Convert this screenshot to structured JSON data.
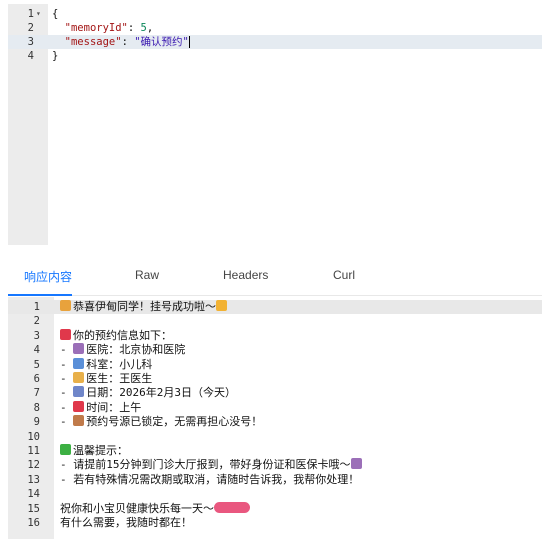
{
  "request_editor": {
    "lines": [
      {
        "num": "1",
        "fold": "▾",
        "parts": [
          {
            "t": "{",
            "c": ""
          }
        ]
      },
      {
        "num": "2",
        "fold": "",
        "parts": [
          {
            "t": "  ",
            "c": ""
          },
          {
            "t": "\"memoryId\"",
            "c": "k"
          },
          {
            "t": ": ",
            "c": ""
          },
          {
            "t": "5",
            "c": "n"
          },
          {
            "t": ",",
            "c": ""
          }
        ]
      },
      {
        "num": "3",
        "fold": "",
        "parts": [
          {
            "t": "  ",
            "c": ""
          },
          {
            "t": "\"message\"",
            "c": "k"
          },
          {
            "t": ": ",
            "c": ""
          },
          {
            "t": "\"确认预约\"",
            "c": "s"
          }
        ],
        "active": true
      },
      {
        "num": "4",
        "fold": "",
        "parts": [
          {
            "t": "}",
            "c": ""
          }
        ]
      }
    ]
  },
  "tabs": [
    {
      "label": "响应内容",
      "active": true
    },
    {
      "label": "Raw",
      "active": false
    },
    {
      "label": "Headers",
      "active": false
    },
    {
      "label": "Curl",
      "active": false
    }
  ],
  "response_editor": {
    "lines": [
      {
        "num": "1",
        "icon": "party-icon",
        "text": "恭喜伊甸同学！挂号成功啦～",
        "tail_icon": "sparkle-icon"
      },
      {
        "num": "2",
        "text": ""
      },
      {
        "num": "3",
        "icon": "pin-icon",
        "text": "你的预约信息如下："
      },
      {
        "num": "4",
        "prefix": "- ",
        "icon": "hospital-icon",
        "text": "医院：北京协和医院"
      },
      {
        "num": "5",
        "prefix": "- ",
        "icon": "stethoscope-icon",
        "text": "科室：小儿科"
      },
      {
        "num": "6",
        "prefix": "- ",
        "icon": "doctor-icon",
        "text": "医生：王医生"
      },
      {
        "num": "7",
        "prefix": "- ",
        "icon": "calendar-icon",
        "text": "日期：2026年2月3日（今天）"
      },
      {
        "num": "8",
        "prefix": "- ",
        "icon": "clock-icon",
        "text": "时间：上午"
      },
      {
        "num": "9",
        "prefix": "- ",
        "icon": "memo-icon",
        "text": "预约号源已锁定，无需再担心没号！"
      },
      {
        "num": "10",
        "text": ""
      },
      {
        "num": "11",
        "icon": "check-icon",
        "text": "温馨提示："
      },
      {
        "num": "12",
        "prefix": "- ",
        "text": "请提前15分钟到门诊大厅报到，带好身份证和医保卡哦～",
        "tail_icon": "hospital-icon"
      },
      {
        "num": "13",
        "prefix": "- ",
        "text": "若有特殊情况需改期或取消，请随时告诉我，我帮你处理！"
      },
      {
        "num": "14",
        "text": ""
      },
      {
        "num": "15",
        "text": "祝你和小宝贝健康快乐每一天～",
        "tail_icon": "flower-baby-heart-icons"
      },
      {
        "num": "16",
        "text": "有什么需要，我随时都在！"
      }
    ]
  },
  "icon_colors": {
    "party-icon": "#e8a23c",
    "sparkle-icon": "#f2b233",
    "pin-icon": "#e0384b",
    "hospital-icon": "#9b6fb8",
    "stethoscope-icon": "#5a8fd8",
    "doctor-icon": "#e8b04a",
    "calendar-icon": "#6f86c9",
    "clock-icon": "#e0384b",
    "memo-icon": "#c07a4a",
    "check-icon": "#3cb043",
    "flower-baby-heart-icons": "#e9577f"
  }
}
